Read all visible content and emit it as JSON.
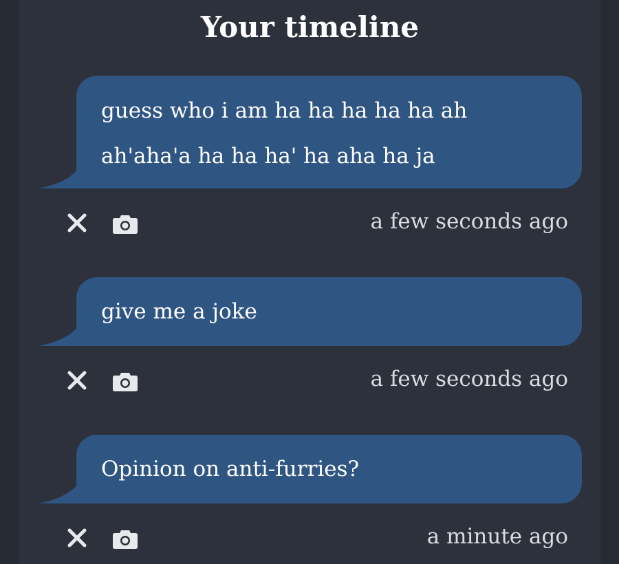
{
  "header": {
    "title": "Your timeline"
  },
  "timeline": {
    "messages": [
      {
        "text": "guess who i am ha ha ha ha ha ah ah'aha'a ha ha ha' ha aha ha ja",
        "time": "a few seconds ago",
        "delete_icon": "close-icon",
        "screenshot_icon": "camera-icon"
      },
      {
        "text": "give me a joke",
        "time": "a few seconds ago",
        "delete_icon": "close-icon",
        "screenshot_icon": "camera-icon"
      },
      {
        "text": "Opinion on anti-furries?",
        "time": "a minute ago",
        "delete_icon": "close-icon",
        "screenshot_icon": "camera-icon"
      }
    ]
  },
  "colors": {
    "background": "#2d313c",
    "outer_background": "#252a33",
    "bubble": "#2f5582",
    "text": "#ffffff",
    "muted_text": "#dadce2"
  }
}
